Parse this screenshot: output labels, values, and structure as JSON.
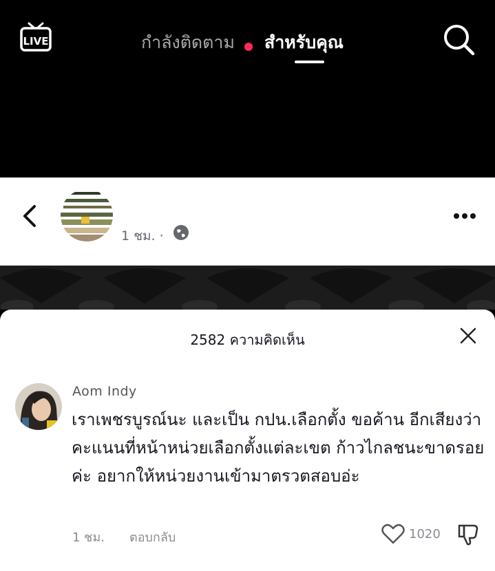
{
  "header": {
    "live_label": "LIVE",
    "tab_following": "กำลังติดตาม",
    "tab_for_you": "สำหรับคุณ",
    "notification_color": "#fe2c55"
  },
  "post": {
    "time": "1 ชม. ·"
  },
  "comments_sheet": {
    "count_title": "2582 ความคิดเห็น",
    "comment": {
      "username": "Aom Indy",
      "text": "เราเพชรบูรณ์นะ และเป็น กปน.เลือกตั้ง ขอค้าน อีกเสียงว่า คะแนนที่หน้าหน่วยเลือกตั้งแต่ละเขต ก้าวไกลชนะขาดรอยค่ะ อยากให้หน่วยงานเข้ามาตรวตสอบอ่ะ",
      "time": "1 ชม.",
      "reply_label": "ตอบกลับ",
      "like_count": "1020"
    }
  },
  "icons": [
    "live-icon",
    "search-icon",
    "back-icon",
    "globe-icon",
    "more-icon",
    "close-icon",
    "heart-icon",
    "dislike-icon"
  ]
}
